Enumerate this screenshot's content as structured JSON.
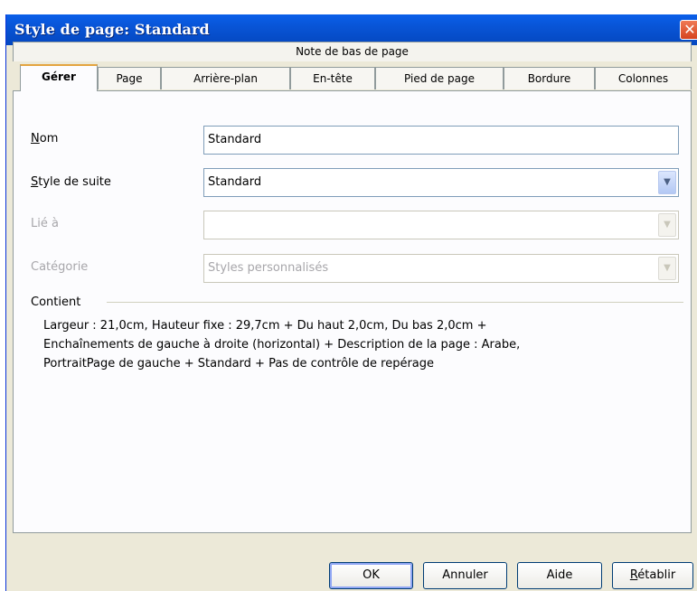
{
  "window": {
    "title": "Style de page: Standard",
    "close_glyph": "✕"
  },
  "tabs": {
    "back_row": "Note de bas de page",
    "items": [
      "Gérer",
      "Page",
      "Arrière-plan",
      "En-tête",
      "Pied de page",
      "Bordure",
      "Colonnes"
    ]
  },
  "fields": {
    "nom": {
      "label": "Nom",
      "value": "Standard"
    },
    "style_suite": {
      "label": "Style de suite",
      "value": "Standard"
    },
    "lie_a": {
      "label": "Lié à",
      "value": ""
    },
    "categorie": {
      "label": "Catégorie",
      "value": "Styles personnalisés"
    }
  },
  "contient": {
    "label": "Contient",
    "lines": [
      "Largeur : 21,0cm, Hauteur fixe : 29,7cm + Du haut 2,0cm, Du bas 2,0cm +",
      "Enchaînements de gauche à droite (horizontal) + Description de la page : Arabe,",
      "PortraitPage de gauche + Standard + Pas de contrôle de repérage"
    ]
  },
  "buttons": {
    "ok": "OK",
    "annuler": "Annuler",
    "aide": "Aide",
    "retablir": "Rétablir"
  },
  "icons": {
    "dropdown": "chevron-down-icon"
  },
  "colors": {
    "titlebar": "#0853d4",
    "close": "#d5431f",
    "active_tab_accent": "#e3a43f"
  }
}
